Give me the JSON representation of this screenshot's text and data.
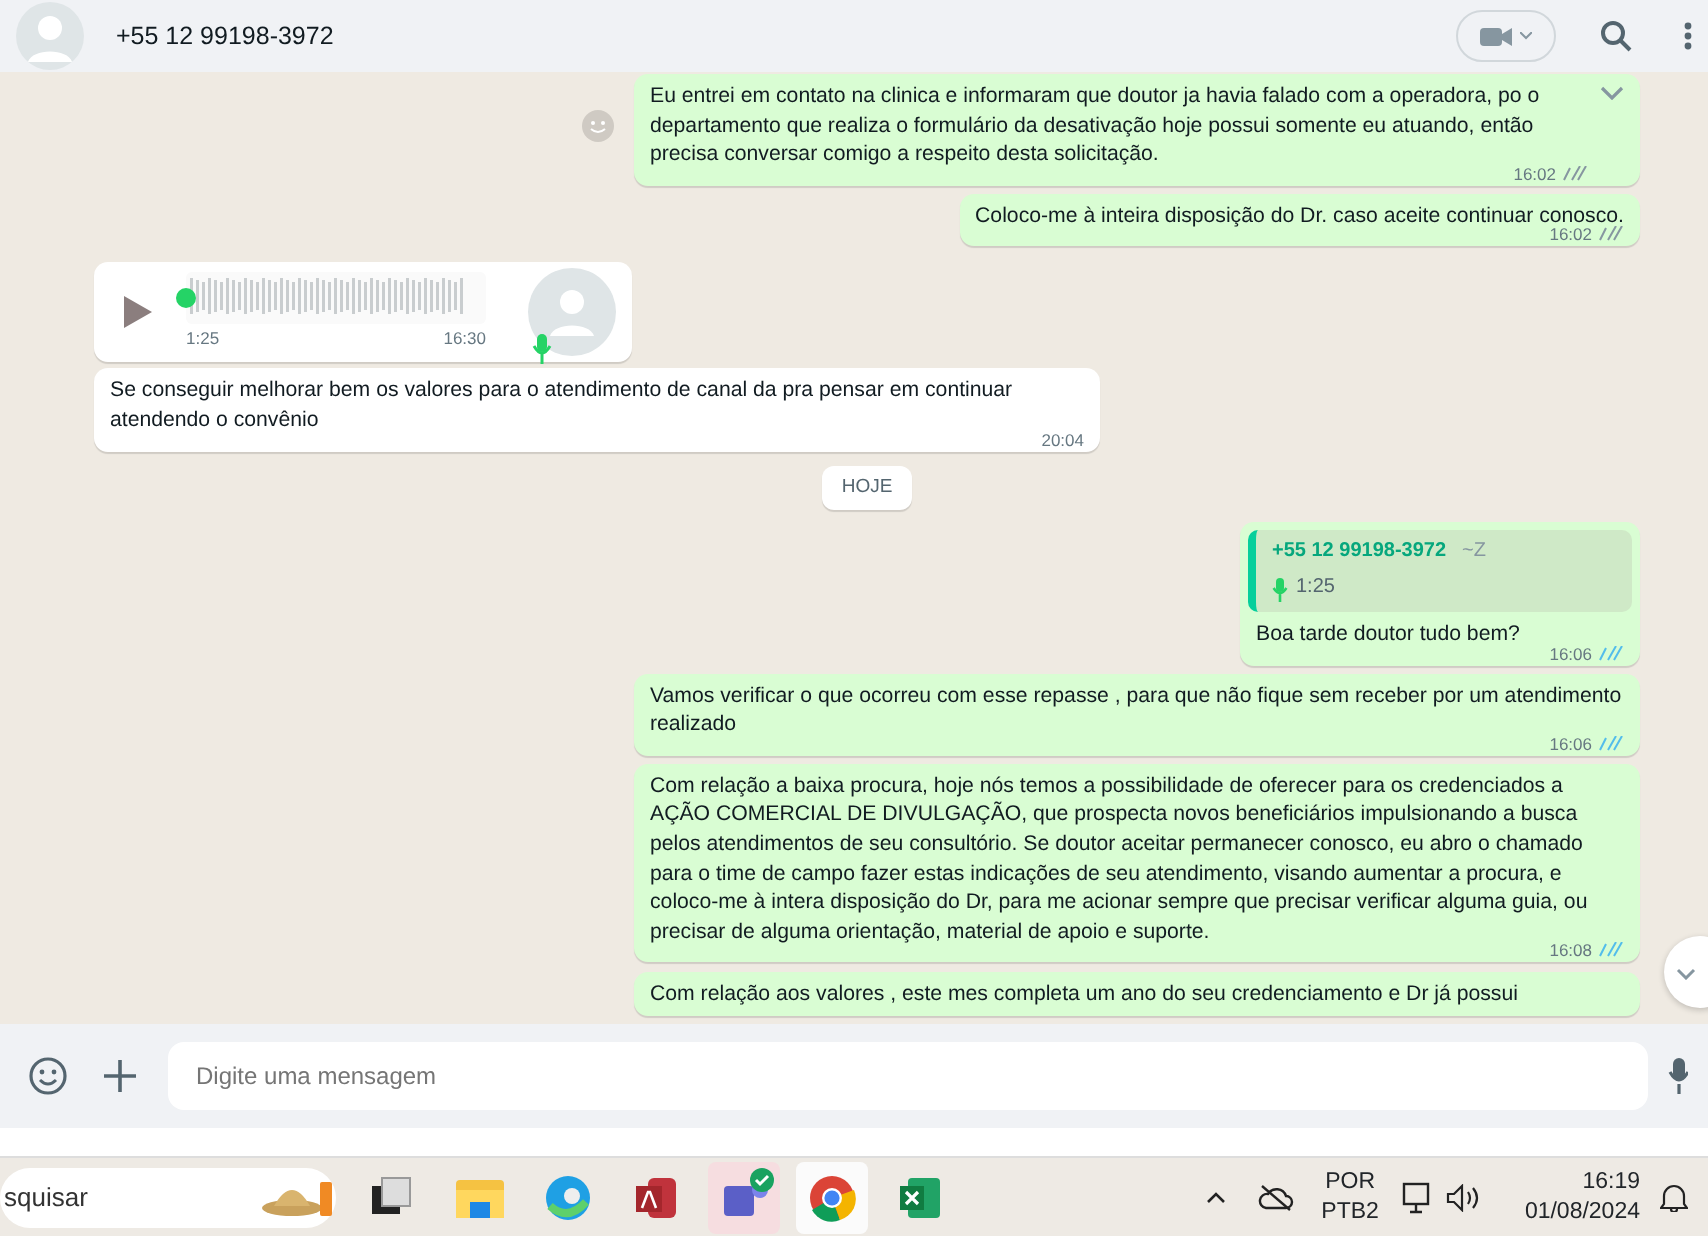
{
  "header": {
    "contact": "+55 12 99198-3972"
  },
  "messages": [
    {
      "kind": "text",
      "outgoing": true,
      "text": "Eu entrei em contato na clinica e informaram que doutor ja havia falado com a operadora, po o departamento que realiza o formulário da desativação hoje possui somente eu atuando, então precisa conversar comigo a respeito desta solicitação.",
      "time": "16:02",
      "read": false,
      "menu": true
    },
    {
      "kind": "text",
      "outgoing": true,
      "text": "Coloco-me à inteira disposição do Dr. caso aceite continuar conosco.",
      "time": "16:02",
      "read": false
    },
    {
      "kind": "audio",
      "outgoing": false,
      "duration": "1:25",
      "time": "16:30",
      "level": 0.0
    },
    {
      "kind": "text",
      "outgoing": false,
      "text": "Se conseguir melhorar bem os valores para o atendimento de canal da pra pensar em continuar atendendo o convênio",
      "time": "20:04"
    },
    {
      "kind": "date",
      "text": "HOJE"
    },
    {
      "kind": "quoted",
      "outgoing": true,
      "quote_author": "+55 12 99198-3972",
      "quote_alias": "~Z",
      "quote_duration": "1:25",
      "text": "Boa tarde doutor tudo bem?",
      "time": "16:06",
      "read": true
    },
    {
      "kind": "text",
      "outgoing": true,
      "text": "Vamos verificar o que ocorreu com esse repasse , para que não fique sem receber por um atendimento realizado",
      "time": "16:06",
      "read": true
    },
    {
      "kind": "text",
      "outgoing": true,
      "text": "Com relação a baixa procura, hoje nós temos a possibilidade de oferecer para os credenciados a AÇÃO COMERCIAL DE DIVULGAÇÃO, que prospecta novos beneficiários impulsionando a busca pelos atendimentos de seu consultório. Se doutor aceitar permanecer conosco, eu abro o chamado para o time de campo fazer estas indicações de seu atendimento, visando aumentar a procura, e coloco-me à intera disposição do Dr, para me acionar sempre que precisar verificar alguma guia, ou precisar de alguma orientação, material de apoio e suporte.",
      "time": "16:08",
      "read": true
    },
    {
      "kind": "partial",
      "outgoing": true,
      "text": "Com relação aos valores , este mes completa um ano do seu credenciamento e Dr já possui"
    }
  ],
  "composer": {
    "placeholder": "Digite uma mensagem"
  },
  "taskbar": {
    "search": "squisar",
    "language": "POR",
    "layout": "PTB2",
    "time": "16:19",
    "date": "01/08/2024"
  }
}
